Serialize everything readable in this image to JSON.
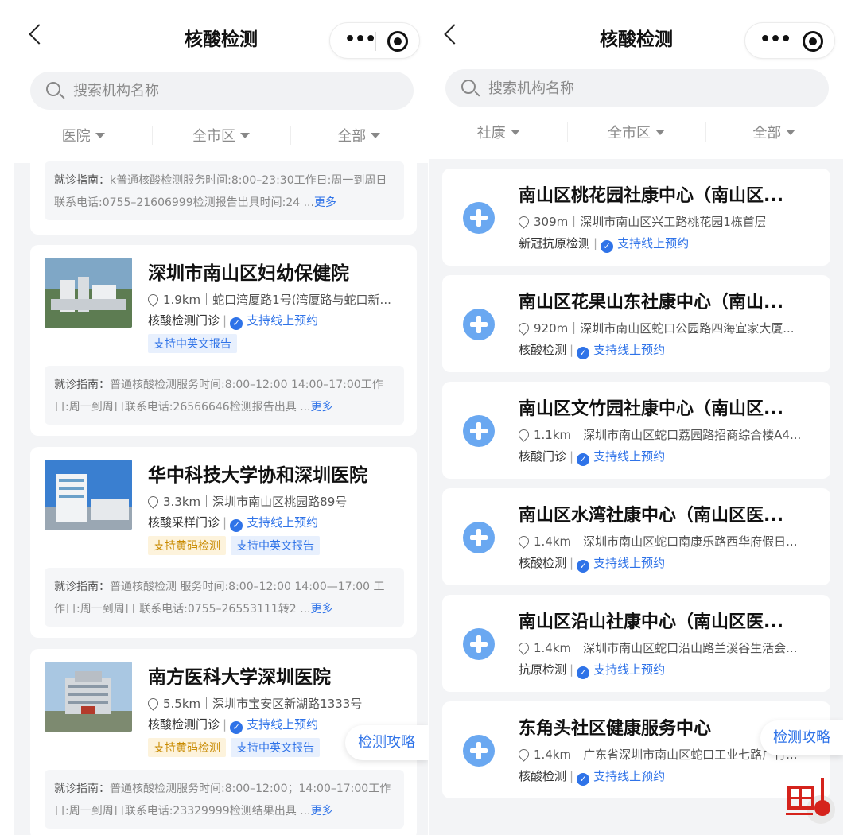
{
  "left": {
    "title": "核酸检测",
    "capsule_more": "•••",
    "search_placeholder": "搜索机构名称",
    "filters": [
      "医院",
      "全市区",
      "全部"
    ],
    "top_guide": {
      "label": "就诊指南：",
      "text": "k普通核酸检测服务时间:8:00–23:30工作日:周一到周日联系电话:0755–21606999检测报告出具时间:24 ...",
      "more": "更多"
    },
    "hospitals": [
      {
        "name": "深圳市南山区妇幼保健院",
        "address": "1.9km｜蛇口湾厦路1号(湾厦路与蛇口新...",
        "service": "核酸检测门诊",
        "booking": "支持线上预约",
        "tags": [
          "支持中英文报告"
        ],
        "guide_label": "就诊指南：",
        "guide": "普通核酸检测服务时间:8:00–12:00 14:00–17:00工作日:周一到周日联系电话:26566646检测报告出具 ...",
        "more": "更多"
      },
      {
        "name": "华中科技大学协和深圳医院",
        "address": "3.3km｜深圳市南山区桃园路89号",
        "service": "核酸采样门诊",
        "booking": "支持线上预约",
        "tags": [
          "支持黄码检测",
          "支持中英文报告"
        ],
        "guide_label": "就诊指南：",
        "guide": "普通核酸检测 服务时间:8:00–12:00 14:00—17:00 工作日:周一到周日 联系电话:0755–26553111转2 ...",
        "more": "更多"
      },
      {
        "name": "南方医科大学深圳医院",
        "address": "5.5km｜深圳市宝安区新湖路1333号",
        "service": "核酸检测门诊",
        "booking": "支持线上预约",
        "tags": [
          "支持黄码检测",
          "支持中英文报告"
        ],
        "guide_label": "就诊指南：",
        "guide": "普通核酸检测服务时间:8:00–12:00；14:00–17:00工作日:周一到周日联系电话:23329999检测结果出具 ...",
        "more": "更多"
      }
    ],
    "fab": "检测攻略"
  },
  "right": {
    "title": "核酸检测",
    "capsule_more": "•••",
    "search_placeholder": "搜索机构名称",
    "filters": [
      "社康",
      "全市区",
      "全部"
    ],
    "centers": [
      {
        "name": "南山区桃花园社康中心（南山区...",
        "address": "309m｜深圳市南山区兴工路桃花园1栋首层",
        "service": "新冠抗原检测",
        "booking": "支持线上预约"
      },
      {
        "name": "南山区花果山东社康中心（南山...",
        "address": "920m｜深圳市南山区蛇口公园路四海宜家大厦...",
        "service": "核酸检测",
        "booking": "支持线上预约"
      },
      {
        "name": "南山区文竹园社康中心（南山区...",
        "address": "1.1km｜深圳市南山区蛇口荔园路招商综合楼A4...",
        "service": "核酸门诊",
        "booking": "支持线上预约"
      },
      {
        "name": "南山区水湾社康中心（南山区医...",
        "address": "1.4km｜深圳市南山区蛇口南康乐路西华府假日...",
        "service": "核酸检测",
        "booking": "支持线上预约"
      },
      {
        "name": "南山区沿山社康中心（南山区医...",
        "address": "1.4km｜深圳市南山区蛇口沿山路兰溪谷生活会...",
        "service": "抗原检测",
        "booking": "支持线上预约"
      },
      {
        "name": "东角头社区健康服务中心",
        "address": "1.4km｜广东省深圳市南山区蛇口工业七路广行...",
        "service": "核酸检测",
        "booking": "支持线上预约"
      }
    ],
    "fab": "检测攻略"
  },
  "colors": {
    "accent": "#2f73e8",
    "badge": "#6aa8f1",
    "tag_yellow": "#c88a00",
    "bg": "#f3f4f6"
  }
}
